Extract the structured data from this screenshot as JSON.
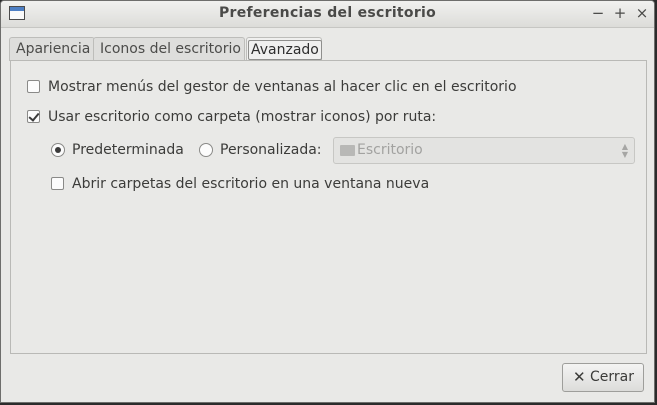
{
  "window": {
    "title": "Preferencias del escritorio",
    "controls": {
      "minimize": "−",
      "maximize": "+",
      "close": "×"
    }
  },
  "tabs": [
    {
      "label": "Apariencia",
      "active": false
    },
    {
      "label": "Iconos del escritorio",
      "active": false
    },
    {
      "label": "Avanzado",
      "active": true
    }
  ],
  "options": {
    "show_wm_menu": {
      "label": "Mostrar menús del gestor de ventanas al hacer clic en el escritorio",
      "checked": false
    },
    "use_desktop_folder": {
      "label": "Usar escritorio como carpeta (mostrar iconos) por ruta:",
      "checked": true
    },
    "path_default": {
      "label": "Predeterminada",
      "selected": true
    },
    "path_custom": {
      "label": "Personalizada:",
      "selected": false
    },
    "folder_select": {
      "value": "Escritorio",
      "enabled": false,
      "icon": "folder-icon"
    },
    "open_new_window": {
      "label": "Abrir carpetas del escritorio en una ventana nueva",
      "checked": false
    }
  },
  "footer": {
    "close_button": {
      "label": "Cerrar",
      "icon": "close-icon"
    }
  }
}
